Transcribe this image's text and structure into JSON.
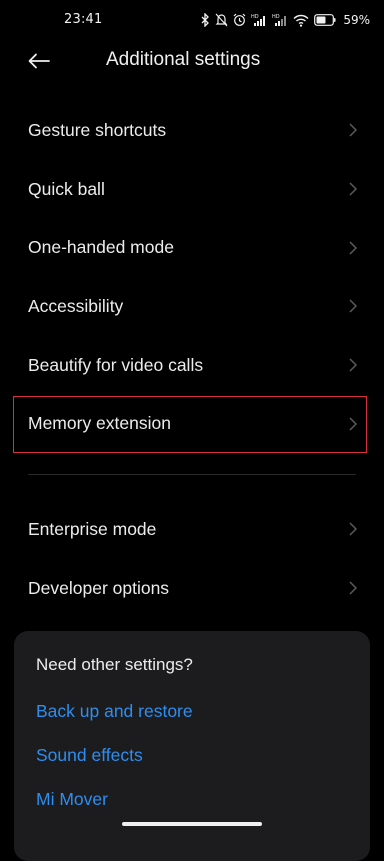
{
  "status_bar": {
    "time": "23:41",
    "battery": "59%",
    "icons": [
      "bluetooth-icon",
      "mute-icon",
      "alarm-icon",
      "signal-hd-icon",
      "signal-hd-icon",
      "wifi-icon",
      "battery-icon"
    ]
  },
  "header": {
    "title": "Additional settings",
    "back_icon": "back-arrow-icon"
  },
  "settings": {
    "items": [
      {
        "label": "Gesture shortcuts"
      },
      {
        "label": "Quick ball"
      },
      {
        "label": "One-handed mode"
      },
      {
        "label": "Accessibility"
      },
      {
        "label": "Beautify for video calls"
      },
      {
        "label": "Memory extension"
      }
    ],
    "items2": [
      {
        "label": "Enterprise mode"
      },
      {
        "label": "Developer options"
      }
    ]
  },
  "card": {
    "title": "Need other settings?",
    "links": [
      {
        "label": "Back up and restore"
      },
      {
        "label": "Sound effects"
      },
      {
        "label": "Mi Mover"
      }
    ]
  },
  "colors": {
    "background": "#000000",
    "link": "#2d8ef0",
    "highlight": "#d6303a",
    "card": "#1c1c1e"
  }
}
